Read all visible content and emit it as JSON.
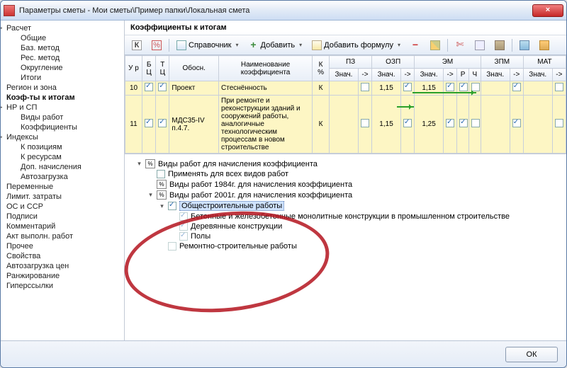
{
  "window": {
    "title": "Параметры сметы - Мои сметы\\Пример папки\\Локальная смета"
  },
  "sidebar": [
    {
      "l": "Расчет",
      "lv": 0,
      "e": 1
    },
    {
      "l": "Общие",
      "lv": 1
    },
    {
      "l": "Баз. метод",
      "lv": 1
    },
    {
      "l": "Рес. метод",
      "lv": 1
    },
    {
      "l": "Округление",
      "lv": 1
    },
    {
      "l": "Итоги",
      "lv": 1
    },
    {
      "l": "Регион и зона",
      "lv": 0
    },
    {
      "l": "Коэф-ты к итогам",
      "lv": 0,
      "sel": 1
    },
    {
      "l": "НР и СП",
      "lv": 0,
      "e": 1
    },
    {
      "l": "Виды работ",
      "lv": 1
    },
    {
      "l": "Коэффициенты",
      "lv": 1
    },
    {
      "l": "Индексы",
      "lv": 0,
      "e": 1
    },
    {
      "l": "К позициям",
      "lv": 1
    },
    {
      "l": "К ресурсам",
      "lv": 1
    },
    {
      "l": "Доп. начисления",
      "lv": 1
    },
    {
      "l": "Автозагрузка",
      "lv": 1
    },
    {
      "l": "Переменные",
      "lv": 0
    },
    {
      "l": "Лимит. затраты",
      "lv": 0
    },
    {
      "l": "ОС и ССР",
      "lv": 0
    },
    {
      "l": "Подписи",
      "lv": 0
    },
    {
      "l": "Комментарий",
      "lv": 0
    },
    {
      "l": "Акт выполн. работ",
      "lv": 0
    },
    {
      "l": "Прочее",
      "lv": 0
    },
    {
      "l": "Свойства",
      "lv": 0
    },
    {
      "l": "Автозагрузка цен",
      "lv": 0
    },
    {
      "l": "Ранжирование",
      "lv": 0
    },
    {
      "l": "Гиперссылки",
      "lv": 0
    }
  ],
  "section": {
    "title": "Коэффициенты к итогам"
  },
  "toolbar": {
    "reference": "Справочник",
    "add": "Добавить",
    "add_formula": "Добавить формулу"
  },
  "headers": {
    "ur": "У\nр",
    "bc": "Б\nЦ",
    "tc": "Т\nЦ",
    "obosn": "Обосн.",
    "name": "Наименование коэффициента",
    "kpct": "К\n%",
    "pz": "ПЗ",
    "ozp": "ОЗП",
    "em": "ЭМ",
    "zpm": "ЗПМ",
    "mat": "МАТ",
    "znach": "Знач.",
    "arrow": "->",
    "r": "Р",
    "ch": "Ч"
  },
  "rows": [
    {
      "n": "10",
      "bc": 1,
      "tc": 1,
      "obosn": "Проект",
      "name": "Стеснённость",
      "k": "К",
      "ozp_v": "1,15",
      "ozp_c": 1,
      "em_v": "1,15",
      "em_c": 1,
      "r": 1,
      "ch": 0,
      "zpm_c": 1
    },
    {
      "n": "11",
      "bc": 1,
      "tc": 1,
      "obosn": "МДС35-IV п.4.7.",
      "name": "При ремонте и реконструкции зданий и сооружений работы, аналогичные технологическим процессам в новом строительстве",
      "k": "К",
      "ozp_v": "1,15",
      "ozp_c": 1,
      "em_v": "1,25",
      "em_c": 1,
      "r": 1,
      "ch": 0,
      "zpm_c": 1
    }
  ],
  "worktypes": [
    {
      "l": "Виды работ для начисления коэффициента",
      "lv": "a",
      "tw": "▾",
      "b": 1
    },
    {
      "l": "Применять для всех видов работ",
      "lv": "b",
      "cb": 0
    },
    {
      "l": "Виды работ 1984г. для начисления коэффициента",
      "lv": "b",
      "b": 1
    },
    {
      "l": "Виды работ 2001г. для начисления коэффициента",
      "lv": "b",
      "tw": "▾",
      "b": 1
    },
    {
      "l": "Общестроительные работы",
      "lv": "c",
      "tw": "▾",
      "cb": 1,
      "sel": 1
    },
    {
      "l": "Бетонные и железобетонные монолитные конструкции в промышленном строительстве",
      "lv": "d",
      "cb": 1,
      "dis": 1
    },
    {
      "l": "Деревянные конструкции",
      "lv": "d",
      "cb": 1,
      "dis": 1
    },
    {
      "l": "Полы",
      "lv": "d",
      "cb": 1,
      "dis": 1
    },
    {
      "l": "Ремонтно-строительные работы",
      "lv": "c",
      "cb": 0,
      "dis": 1
    }
  ],
  "footer": {
    "ok": "ОК"
  }
}
